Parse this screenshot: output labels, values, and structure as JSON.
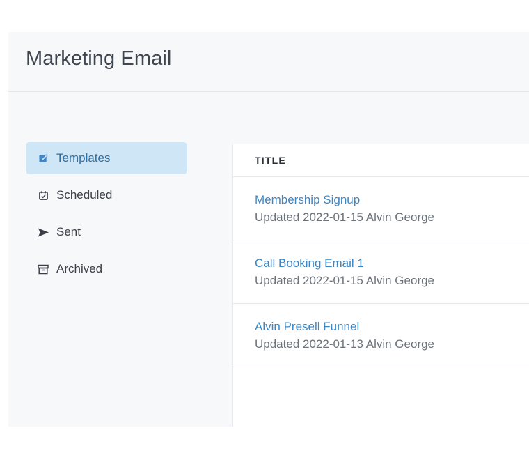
{
  "header": {
    "title": "Marketing Email"
  },
  "sidebar": {
    "items": [
      {
        "label": "Templates",
        "icon": "edit-square-icon",
        "active": true
      },
      {
        "label": "Scheduled",
        "icon": "calendar-check-icon",
        "active": false
      },
      {
        "label": "Sent",
        "icon": "send-icon",
        "active": false
      },
      {
        "label": "Archived",
        "icon": "archive-box-icon",
        "active": false
      }
    ]
  },
  "table": {
    "column_header": "TITLE",
    "rows": [
      {
        "title": "Membership Signup",
        "meta": "Updated 2022-01-15 Alvin George"
      },
      {
        "title": "Call Booking Email 1",
        "meta": "Updated 2022-01-15 Alvin George"
      },
      {
        "title": "Alvin Presell Funnel",
        "meta": "Updated 2022-01-13 Alvin George"
      }
    ]
  },
  "colors": {
    "accent": "#3c86c4",
    "active_bg": "#cfe6f6",
    "panel_bg": "#f7f8fa",
    "divider": "#e4e7eb"
  }
}
